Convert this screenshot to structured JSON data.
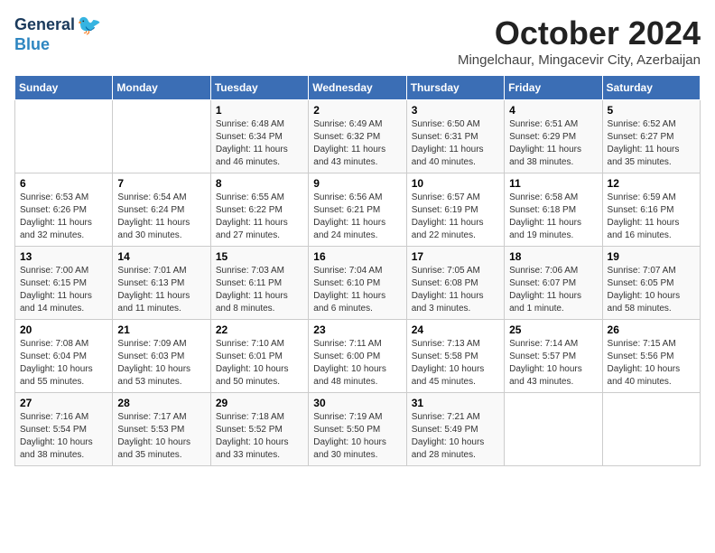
{
  "logo": {
    "general": "General",
    "blue": "Blue"
  },
  "title": "October 2024",
  "location": "Mingelchaur, Mingacevir City, Azerbaijan",
  "weekdays": [
    "Sunday",
    "Monday",
    "Tuesday",
    "Wednesday",
    "Thursday",
    "Friday",
    "Saturday"
  ],
  "weeks": [
    [
      {
        "day": "",
        "sunrise": "",
        "sunset": "",
        "daylight": ""
      },
      {
        "day": "",
        "sunrise": "",
        "sunset": "",
        "daylight": ""
      },
      {
        "day": "1",
        "sunrise": "Sunrise: 6:48 AM",
        "sunset": "Sunset: 6:34 PM",
        "daylight": "Daylight: 11 hours and 46 minutes."
      },
      {
        "day": "2",
        "sunrise": "Sunrise: 6:49 AM",
        "sunset": "Sunset: 6:32 PM",
        "daylight": "Daylight: 11 hours and 43 minutes."
      },
      {
        "day": "3",
        "sunrise": "Sunrise: 6:50 AM",
        "sunset": "Sunset: 6:31 PM",
        "daylight": "Daylight: 11 hours and 40 minutes."
      },
      {
        "day": "4",
        "sunrise": "Sunrise: 6:51 AM",
        "sunset": "Sunset: 6:29 PM",
        "daylight": "Daylight: 11 hours and 38 minutes."
      },
      {
        "day": "5",
        "sunrise": "Sunrise: 6:52 AM",
        "sunset": "Sunset: 6:27 PM",
        "daylight": "Daylight: 11 hours and 35 minutes."
      }
    ],
    [
      {
        "day": "6",
        "sunrise": "Sunrise: 6:53 AM",
        "sunset": "Sunset: 6:26 PM",
        "daylight": "Daylight: 11 hours and 32 minutes."
      },
      {
        "day": "7",
        "sunrise": "Sunrise: 6:54 AM",
        "sunset": "Sunset: 6:24 PM",
        "daylight": "Daylight: 11 hours and 30 minutes."
      },
      {
        "day": "8",
        "sunrise": "Sunrise: 6:55 AM",
        "sunset": "Sunset: 6:22 PM",
        "daylight": "Daylight: 11 hours and 27 minutes."
      },
      {
        "day": "9",
        "sunrise": "Sunrise: 6:56 AM",
        "sunset": "Sunset: 6:21 PM",
        "daylight": "Daylight: 11 hours and 24 minutes."
      },
      {
        "day": "10",
        "sunrise": "Sunrise: 6:57 AM",
        "sunset": "Sunset: 6:19 PM",
        "daylight": "Daylight: 11 hours and 22 minutes."
      },
      {
        "day": "11",
        "sunrise": "Sunrise: 6:58 AM",
        "sunset": "Sunset: 6:18 PM",
        "daylight": "Daylight: 11 hours and 19 minutes."
      },
      {
        "day": "12",
        "sunrise": "Sunrise: 6:59 AM",
        "sunset": "Sunset: 6:16 PM",
        "daylight": "Daylight: 11 hours and 16 minutes."
      }
    ],
    [
      {
        "day": "13",
        "sunrise": "Sunrise: 7:00 AM",
        "sunset": "Sunset: 6:15 PM",
        "daylight": "Daylight: 11 hours and 14 minutes."
      },
      {
        "day": "14",
        "sunrise": "Sunrise: 7:01 AM",
        "sunset": "Sunset: 6:13 PM",
        "daylight": "Daylight: 11 hours and 11 minutes."
      },
      {
        "day": "15",
        "sunrise": "Sunrise: 7:03 AM",
        "sunset": "Sunset: 6:11 PM",
        "daylight": "Daylight: 11 hours and 8 minutes."
      },
      {
        "day": "16",
        "sunrise": "Sunrise: 7:04 AM",
        "sunset": "Sunset: 6:10 PM",
        "daylight": "Daylight: 11 hours and 6 minutes."
      },
      {
        "day": "17",
        "sunrise": "Sunrise: 7:05 AM",
        "sunset": "Sunset: 6:08 PM",
        "daylight": "Daylight: 11 hours and 3 minutes."
      },
      {
        "day": "18",
        "sunrise": "Sunrise: 7:06 AM",
        "sunset": "Sunset: 6:07 PM",
        "daylight": "Daylight: 11 hours and 1 minute."
      },
      {
        "day": "19",
        "sunrise": "Sunrise: 7:07 AM",
        "sunset": "Sunset: 6:05 PM",
        "daylight": "Daylight: 10 hours and 58 minutes."
      }
    ],
    [
      {
        "day": "20",
        "sunrise": "Sunrise: 7:08 AM",
        "sunset": "Sunset: 6:04 PM",
        "daylight": "Daylight: 10 hours and 55 minutes."
      },
      {
        "day": "21",
        "sunrise": "Sunrise: 7:09 AM",
        "sunset": "Sunset: 6:03 PM",
        "daylight": "Daylight: 10 hours and 53 minutes."
      },
      {
        "day": "22",
        "sunrise": "Sunrise: 7:10 AM",
        "sunset": "Sunset: 6:01 PM",
        "daylight": "Daylight: 10 hours and 50 minutes."
      },
      {
        "day": "23",
        "sunrise": "Sunrise: 7:11 AM",
        "sunset": "Sunset: 6:00 PM",
        "daylight": "Daylight: 10 hours and 48 minutes."
      },
      {
        "day": "24",
        "sunrise": "Sunrise: 7:13 AM",
        "sunset": "Sunset: 5:58 PM",
        "daylight": "Daylight: 10 hours and 45 minutes."
      },
      {
        "day": "25",
        "sunrise": "Sunrise: 7:14 AM",
        "sunset": "Sunset: 5:57 PM",
        "daylight": "Daylight: 10 hours and 43 minutes."
      },
      {
        "day": "26",
        "sunrise": "Sunrise: 7:15 AM",
        "sunset": "Sunset: 5:56 PM",
        "daylight": "Daylight: 10 hours and 40 minutes."
      }
    ],
    [
      {
        "day": "27",
        "sunrise": "Sunrise: 7:16 AM",
        "sunset": "Sunset: 5:54 PM",
        "daylight": "Daylight: 10 hours and 38 minutes."
      },
      {
        "day": "28",
        "sunrise": "Sunrise: 7:17 AM",
        "sunset": "Sunset: 5:53 PM",
        "daylight": "Daylight: 10 hours and 35 minutes."
      },
      {
        "day": "29",
        "sunrise": "Sunrise: 7:18 AM",
        "sunset": "Sunset: 5:52 PM",
        "daylight": "Daylight: 10 hours and 33 minutes."
      },
      {
        "day": "30",
        "sunrise": "Sunrise: 7:19 AM",
        "sunset": "Sunset: 5:50 PM",
        "daylight": "Daylight: 10 hours and 30 minutes."
      },
      {
        "day": "31",
        "sunrise": "Sunrise: 7:21 AM",
        "sunset": "Sunset: 5:49 PM",
        "daylight": "Daylight: 10 hours and 28 minutes."
      },
      {
        "day": "",
        "sunrise": "",
        "sunset": "",
        "daylight": ""
      },
      {
        "day": "",
        "sunrise": "",
        "sunset": "",
        "daylight": ""
      }
    ]
  ]
}
